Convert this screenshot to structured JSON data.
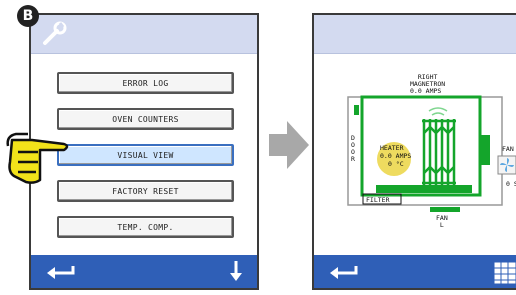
{
  "badge_label": "B",
  "left_screen": {
    "menu_items": [
      {
        "label": "ERROR LOG",
        "selected": false
      },
      {
        "label": "OVEN COUNTERS",
        "selected": false
      },
      {
        "label": "VISUAL VIEW",
        "selected": true
      },
      {
        "label": "FACTORY RESET",
        "selected": false
      },
      {
        "label": "TEMP. COMP.",
        "selected": false
      }
    ],
    "icons": {
      "header": "wrench-icon",
      "back": "back-arrow-icon",
      "scroll": "down-arrow-icon",
      "pointer": "pointing-hand-icon"
    }
  },
  "right_screen": {
    "right_magnetron_label": "RIGHT\nMAGNETRON",
    "right_magnetron_amps": "0.0 AMPS",
    "door_label": "D\nO\nO\nR",
    "heater_label": "HEATER",
    "heater_amps": "0.0 AMPS",
    "heater_temp": "0 °C",
    "filter_label": "FILTER",
    "fan_l_label": "FAN\nL",
    "fan_r_label": "FAN",
    "fan_r_value": "0 S",
    "icons": {
      "back": "back-arrow-icon",
      "grid": "grid-icon",
      "fan": "fan-icon",
      "heater": "heater-glow",
      "magnetron": "magnetron-coil"
    }
  },
  "colors": {
    "header": "#d3daf0",
    "footer": "#2f5fb7",
    "diagram": "#14a52b",
    "heater_glow": "#e8cf2a",
    "selected": "#cfe6ff",
    "arrow": "#a8a8a8"
  }
}
